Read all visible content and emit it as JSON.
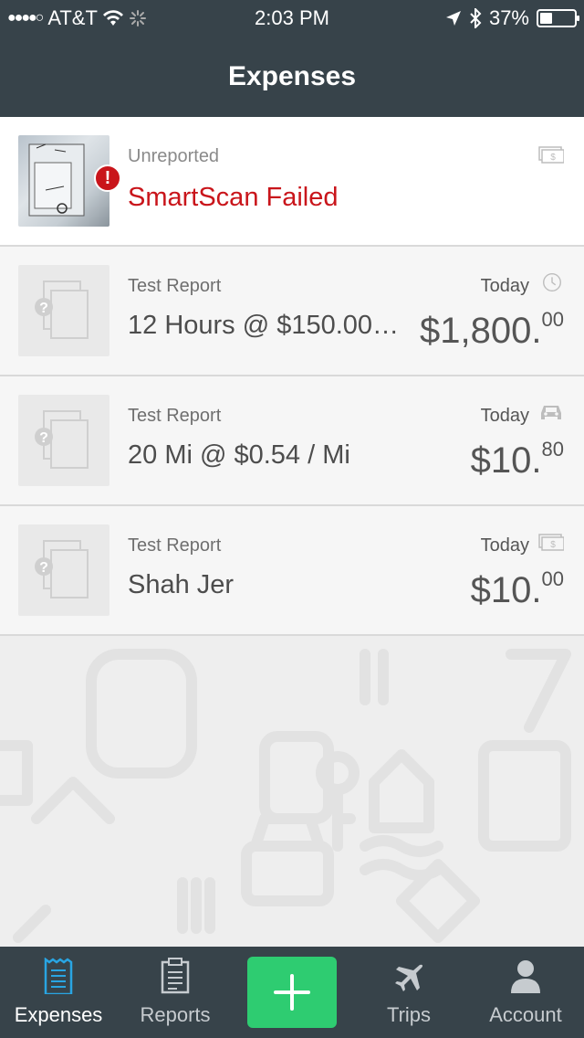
{
  "status_bar": {
    "carrier": "AT&T",
    "time": "2:03 PM",
    "battery": "37%",
    "battery_level": 0.37
  },
  "nav": {
    "title": "Expenses"
  },
  "expenses": [
    {
      "meta": "Unreported",
      "title": "SmartScan Failed",
      "status": "error",
      "type_icon": "cash-icon"
    },
    {
      "meta": "Test Report",
      "title": "12 Hours @ $150.00…",
      "when": "Today",
      "amount_main": "$1,800",
      "amount_cents": "00",
      "type_icon": "clock-icon"
    },
    {
      "meta": "Test Report",
      "title": "20 Mi @ $0.54 / Mi",
      "when": "Today",
      "amount_main": "$10",
      "amount_cents": "80",
      "type_icon": "car-icon"
    },
    {
      "meta": "Test Report",
      "title": "Shah Jer",
      "when": "Today",
      "amount_main": "$10",
      "amount_cents": "00",
      "type_icon": "cash-icon"
    }
  ],
  "tabs": [
    {
      "label": "Expenses",
      "icon": "receipt-icon",
      "active": true
    },
    {
      "label": "Reports",
      "icon": "report-icon",
      "active": false
    },
    {
      "label": "Trips",
      "icon": "plane-icon",
      "active": false
    },
    {
      "label": "Account",
      "icon": "person-icon",
      "active": false
    }
  ],
  "colors": {
    "header": "#37434a",
    "error": "#c9151b",
    "accent": "#2ecc71",
    "active_tab": "#29a5e3"
  }
}
